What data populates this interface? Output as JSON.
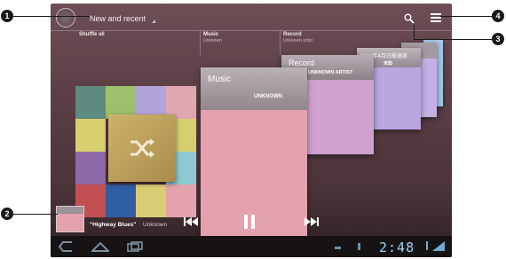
{
  "topbar": {
    "view_selector": "New and recent"
  },
  "columns": [
    {
      "title": "Shuffle all",
      "subtitle": ""
    },
    {
      "title": "Music",
      "subtitle": "Unknown"
    },
    {
      "title": "Record",
      "subtitle": "Unknown artist"
    }
  ],
  "cards": {
    "music": {
      "title": "Music",
      "artist": "UNKNOWN"
    },
    "record": {
      "title": "Record",
      "artist": "UNKNOWN ARTIST"
    },
    "third": {
      "title": "2010年4月日报速递",
      "artist": "未知"
    }
  },
  "now_playing": {
    "title": "\"Highway Blues\"",
    "artist": "Unknown"
  },
  "status": {
    "clock": "2:48"
  },
  "callouts": [
    "1",
    "2",
    "3",
    "4"
  ],
  "icons": [
    "app-logo-icon",
    "search-icon",
    "menu-icon",
    "shuffle-icon",
    "previous-icon",
    "pause-icon",
    "next-icon",
    "back-icon",
    "home-icon",
    "recent-apps-icon"
  ],
  "colors": {
    "background": "#5c3f46",
    "clock": "#9ed2f6",
    "music_card": "#e3a2ad",
    "record_card": "#d0a0cf"
  }
}
